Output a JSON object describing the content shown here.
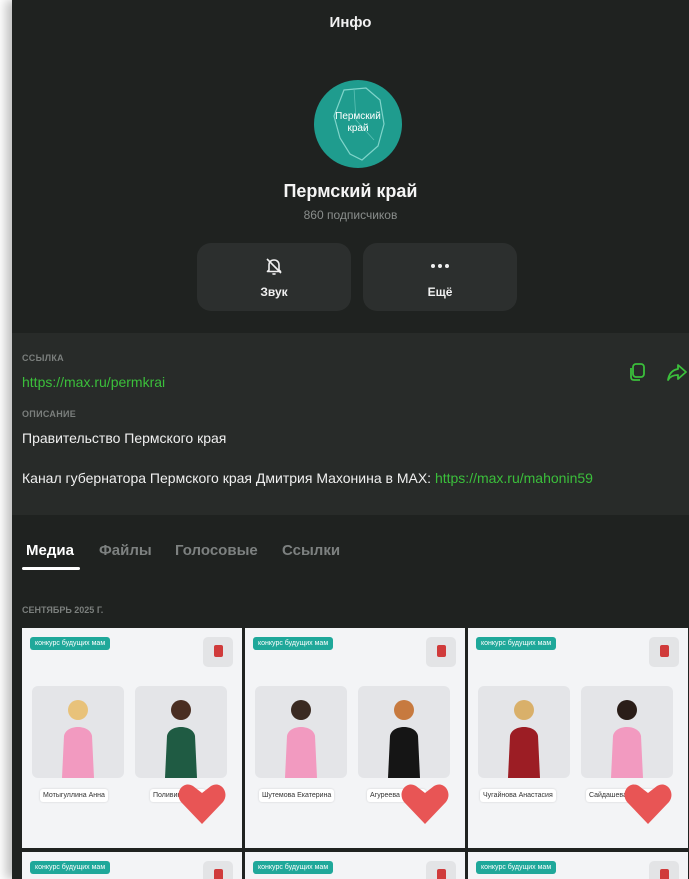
{
  "header": {
    "title": "Инфо"
  },
  "channel": {
    "avatar_text_line1": "Пермский",
    "avatar_text_line2": "край",
    "name": "Пермский край",
    "subscribers": "860 подписчиков"
  },
  "actions": [
    {
      "label": "Звук",
      "icon": "bell-off-icon"
    },
    {
      "label": "Ещё",
      "icon": "more-dots-icon"
    }
  ],
  "info": {
    "link_label": "ССЫЛКА",
    "link": "https://max.ru/permkrai",
    "description_label": "ОПИСАНИЕ",
    "description_line1": "Правительство Пермского края",
    "description_line2_text": "Канал губернатора Пермского края Дмитрия Махонина в MAX: ",
    "description_line2_link": "https://max.ru/mahonin59",
    "icons": [
      "copy-icon",
      "share-icon"
    ]
  },
  "tabs": [
    {
      "label": "Медиа",
      "active": true
    },
    {
      "label": "Файлы",
      "active": false
    },
    {
      "label": "Голосовые",
      "active": false
    },
    {
      "label": "Ссылки",
      "active": false
    }
  ],
  "media": {
    "date_label": "СЕНТЯБРЬ 2025 Г.",
    "tag": "конкурс будущих мам",
    "items": [
      {
        "names": [
          "Мотыгуллина Анна",
          "Поливина Анна"
        ]
      },
      {
        "names": [
          "Шутемова Екатерина",
          "Агуреева Мария"
        ]
      },
      {
        "names": [
          "Чугайнова Анастасия",
          "Сайдашева Альмира"
        ]
      }
    ]
  },
  "colors": {
    "accent": "#3bbf3b",
    "background": "#1f2220",
    "card": "#2c2f2e",
    "tag": "#1fa89a"
  }
}
